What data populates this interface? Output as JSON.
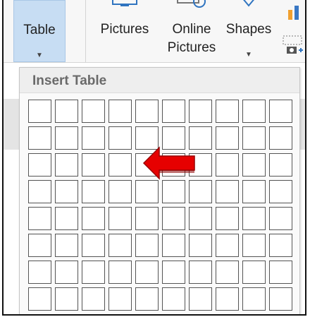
{
  "ribbon": {
    "table": {
      "label": "Table",
      "caret": "▼"
    },
    "pictures": {
      "label": "Pictures"
    },
    "online_pictures": {
      "label_line1": "Online",
      "label_line2": "Pictures"
    },
    "shapes": {
      "label": "Shapes",
      "caret": "▼"
    },
    "icons": {
      "picture_icon": "picture-icon",
      "online-picture-icon": "online-picture-icon",
      "shape-icon": "shape-icon",
      "chart-icon": "chart-icon",
      "screenshot-icon": "screenshot-icon"
    }
  },
  "insert_table": {
    "title": "Insert Table",
    "rows": 8,
    "columns": 10
  },
  "annotation": {
    "arrow_color": "#ff0000",
    "arrow_icon": "red-arrow-icon"
  },
  "colors": {
    "selected_button": "#c7ddf3",
    "chart_orange": "#f0a030",
    "chart_blue": "#3a78c4"
  }
}
